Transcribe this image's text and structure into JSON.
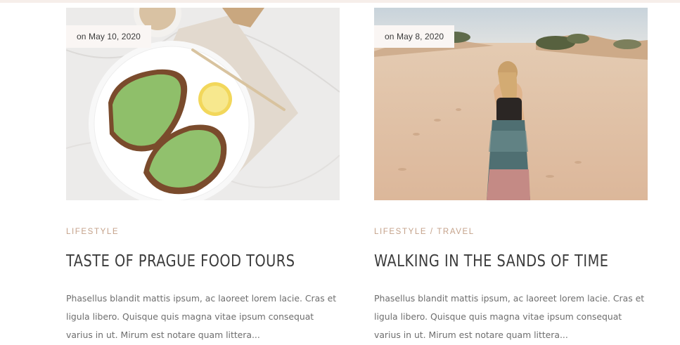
{
  "posts": [
    {
      "date": "on May 10, 2020",
      "categories": [
        "LIFESTYLE"
      ],
      "title": "TASTE OF PRAGUE FOOD TOURS",
      "excerpt": "Phasellus blandit mattis ipsum, ac laoreet lorem lacie. Cras et ligula libero. Quisque quis magna vitae ipsum consequat varius in ut. Mirum est notare quam littera..."
    },
    {
      "date": "on May 8, 2020",
      "categories": [
        "LIFESTYLE",
        "TRAVEL"
      ],
      "category_separator": " / ",
      "title": "WALKING IN THE SANDS OF TIME",
      "excerpt": "Phasellus blandit mattis ipsum, ac laoreet lorem lacie. Cras et ligula libero. Quisque quis magna vitae ipsum consequat varius in ut. Mirum est notare quam littera..."
    }
  ],
  "colors": {
    "category": "#c4a28a",
    "title": "#3b3b3b",
    "excerpt": "#6e6e6e",
    "badge_bg": "#faf6f4"
  }
}
